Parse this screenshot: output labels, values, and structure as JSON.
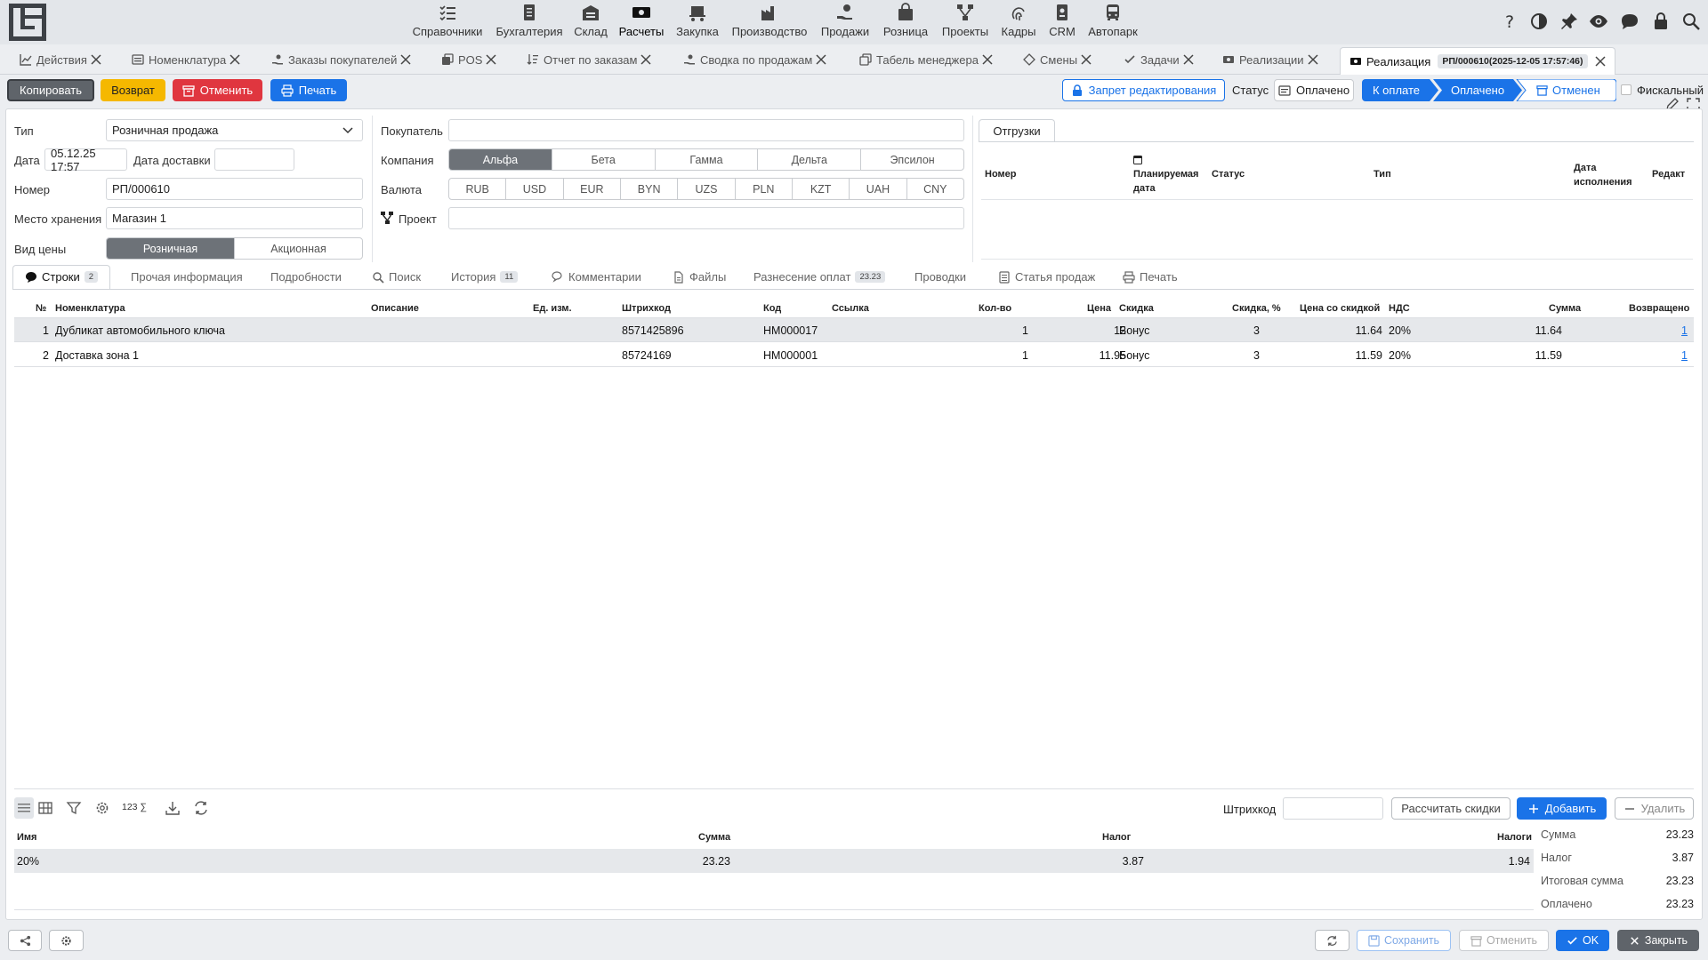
{
  "nav": {
    "items": [
      {
        "label": "Справочники",
        "icon": "list-check-icon"
      },
      {
        "label": "Бухгалтерия",
        "icon": "ledger-icon"
      },
      {
        "label": "Склад",
        "icon": "warehouse-icon"
      },
      {
        "label": "Расчеты",
        "icon": "cash-icon"
      },
      {
        "label": "Закупка",
        "icon": "cart-icon"
      },
      {
        "label": "Производство",
        "icon": "factory-icon"
      },
      {
        "label": "Продажи",
        "icon": "hand-coin-icon"
      },
      {
        "label": "Розница",
        "icon": "shopping-bag-icon"
      },
      {
        "label": "Проекты",
        "icon": "hierarchy-icon"
      },
      {
        "label": "Кадры",
        "icon": "fingerprint-icon"
      },
      {
        "label": "CRM",
        "icon": "id-badge-icon"
      },
      {
        "label": "Автопарк",
        "icon": "bus-icon"
      }
    ]
  },
  "tabs": [
    {
      "label": "Действия",
      "icon": "chart-icon"
    },
    {
      "label": "Номенклатура",
      "icon": "list-icon"
    },
    {
      "label": "Заказы покупателей",
      "icon": "hand-icon"
    },
    {
      "label": "POS",
      "icon": "copy-icon"
    },
    {
      "label": "Отчет по заказам",
      "icon": "sort-icon"
    },
    {
      "label": "Сводка по продажам",
      "icon": "hand-icon"
    },
    {
      "label": "Табель менеджера",
      "icon": "copy-icon"
    },
    {
      "label": "Смены",
      "icon": "diamond-icon"
    },
    {
      "label": "Задачи",
      "icon": "check-icon"
    },
    {
      "label": "Реализации",
      "icon": "cash-icon"
    },
    {
      "label": "Реализация",
      "icon": "cash-icon",
      "chip": "РП/000610(2025-12-05 17:57:46)"
    }
  ],
  "actions": {
    "copy": "Копировать",
    "return": "Возврат",
    "cancel": "Отменить",
    "print": "Печать"
  },
  "status_bar": {
    "lock": "Запрет редактирования",
    "status_label": "Статус",
    "status_value": "Оплачено",
    "steps": [
      "К оплате",
      "Оплачено",
      "Отменен"
    ],
    "fiscal": "Фискальный"
  },
  "form": {
    "type_label": "Тип",
    "type_value": "Розничная продажа",
    "date_label": "Дата",
    "date_value": "05.12.25 17:57",
    "delivery_label": "Дата доставки",
    "delivery_value": "",
    "number_label": "Номер",
    "number_value": "РП/000610",
    "storage_label": "Место хранения",
    "storage_value": "Магазин 1",
    "price_kind_label": "Вид цены",
    "price_kinds": [
      "Розничная",
      "Акционная"
    ],
    "buyer_label": "Покупатель",
    "buyer_value": "",
    "company_label": "Компания",
    "companies": [
      "Альфа",
      "Бета",
      "Гамма",
      "Дельта",
      "Эпсилон"
    ],
    "currency_label": "Валюта",
    "currencies": [
      "RUB",
      "USD",
      "EUR",
      "BYN",
      "UZS",
      "PLN",
      "KZT",
      "UAH",
      "CNY"
    ],
    "project_label": "Проект",
    "project_value": ""
  },
  "shipments": {
    "tab": "Отгрузки",
    "headers": [
      "Номер",
      "Планируемая дата",
      "Статус",
      "Тип",
      "Дата исполнения",
      "Редакт"
    ]
  },
  "section_tabs": [
    {
      "label": "Строки",
      "count": "2"
    },
    {
      "label": "Прочая информация"
    },
    {
      "label": "Подробности"
    },
    {
      "label": "Поиск"
    },
    {
      "label": "История",
      "count": "11"
    },
    {
      "label": "Комментарии"
    },
    {
      "label": "Файлы"
    },
    {
      "label": "Разнесение оплат",
      "count": "23.23"
    },
    {
      "label": "Проводки"
    },
    {
      "label": "Статья продаж"
    },
    {
      "label": "Печать"
    }
  ],
  "grid": {
    "headers": [
      "№",
      "Номенклатура",
      "Описание",
      "Ед. изм.",
      "Штрихкод",
      "Код",
      "Ссылка",
      "Кол-во",
      "Цена",
      "Скидка",
      "Скидка, %",
      "Цена со скидкой",
      "НДС",
      "Сумма",
      "Возвращено"
    ],
    "rows": [
      {
        "n": "1",
        "name": "Дубликат автомобильного ключа",
        "desc": "",
        "unit": "",
        "barcode": "8571425896",
        "code": "НМ000017",
        "link": "",
        "qty": "1",
        "price": "12",
        "discount": "Бонус",
        "disc_pct": "3",
        "disc_price": "11.64",
        "vat": "20%",
        "sum": "11.64",
        "returned": "1"
      },
      {
        "n": "2",
        "name": "Доставка зона 1",
        "desc": "",
        "unit": "",
        "barcode": "85724169",
        "code": "НМ000001",
        "link": "",
        "qty": "1",
        "price": "11.95",
        "discount": "Бонус",
        "disc_pct": "3",
        "disc_price": "11.59",
        "vat": "20%",
        "sum": "11.59",
        "returned": "1"
      }
    ]
  },
  "toolbar": {
    "sum_icon_label": "123 ∑",
    "barcode_label": "Штрихкод",
    "barcode_value": "",
    "calc_discounts": "Рассчитать скидки",
    "add": "Добавить",
    "delete": "Удалить"
  },
  "tax": {
    "headers": [
      "Имя",
      "Сумма",
      "Налог",
      "Налоги"
    ],
    "row": {
      "name": "20%",
      "sum": "23.23",
      "tax": "3.87",
      "taxes": "1.94"
    }
  },
  "totals": [
    {
      "label": "Сумма",
      "value": "23.23"
    },
    {
      "label": "Налог",
      "value": "3.87"
    },
    {
      "label": "Итоговая сумма",
      "value": "23.23"
    },
    {
      "label": "Оплачено",
      "value": "23.23"
    }
  ],
  "footer": {
    "save": "Сохранить",
    "cancel": "Отменить",
    "ok": "OK",
    "close": "Закрыть"
  },
  "colors": {
    "primary": "#1a73e8",
    "warning": "#f5b800",
    "danger": "#e0363f",
    "dark": "#5f646a"
  }
}
